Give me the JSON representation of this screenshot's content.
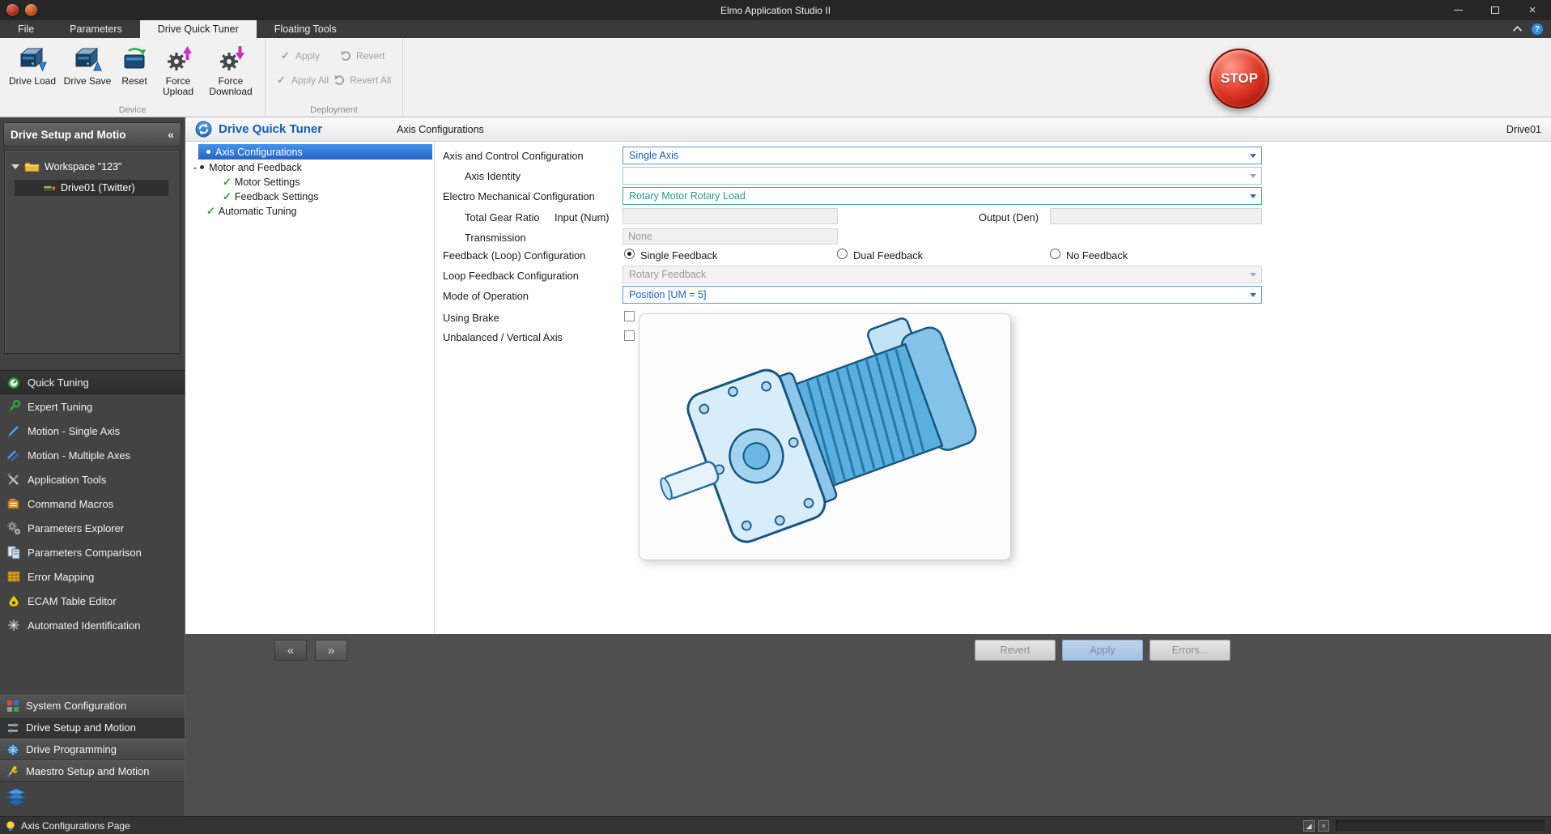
{
  "titlebar": {
    "title": "Elmo Application Studio II"
  },
  "menubar": {
    "tabs": [
      "File",
      "Parameters",
      "Drive Quick Tuner",
      "Floating Tools"
    ]
  },
  "ribbon": {
    "groups": {
      "device": {
        "label": "Device",
        "drive_load": "Drive Load",
        "drive_save": "Drive Save",
        "reset": "Reset",
        "force_upload": "Force Upload",
        "force_download": "Force Download"
      },
      "deployment": {
        "label": "Deployment",
        "apply": "Apply",
        "revert": "Revert",
        "apply_all": "Apply All",
        "revert_all": "Revert All"
      }
    },
    "stop": "STOP"
  },
  "sidebar": {
    "header": "Drive Setup and Motio",
    "workspace": "Workspace \"123\"",
    "drive": "Drive01 (Twitter)",
    "items": [
      {
        "label": "Quick Tuning"
      },
      {
        "label": "Expert Tuning"
      },
      {
        "label": "Motion - Single Axis"
      },
      {
        "label": "Motion - Multiple Axes"
      },
      {
        "label": "Application Tools"
      },
      {
        "label": "Command Macros"
      },
      {
        "label": "Parameters Explorer"
      },
      {
        "label": "Parameters Comparison"
      },
      {
        "label": "Error Mapping"
      },
      {
        "label": "ECAM Table Editor"
      },
      {
        "label": "Automated Identification"
      }
    ],
    "bottom_items": [
      {
        "label": "System Configuration"
      },
      {
        "label": "Drive Setup and Motion"
      },
      {
        "label": "Drive Programming"
      },
      {
        "label": "Maestro Setup and Motion"
      }
    ]
  },
  "content": {
    "header": {
      "title": "Drive Quick Tuner",
      "breadcrumb": "Axis Configurations",
      "drive_name": "Drive01"
    },
    "tree": {
      "axis_configurations": "Axis Configurations",
      "motor_and_feedback": "Motor and Feedback",
      "motor_settings": "Motor Settings",
      "feedback_settings": "Feedback Settings",
      "automatic_tuning": "Automatic Tuning"
    },
    "form": {
      "axis_control": {
        "label": "Axis and Control Configuration",
        "value": "Single Axis"
      },
      "axis_identity": {
        "label": "Axis Identity",
        "value": ""
      },
      "electro_mech": {
        "label": "Electro Mechanical Configuration",
        "value": "Rotary Motor Rotary Load"
      },
      "gear_ratio": {
        "label": "Total Gear Ratio",
        "input_label": "Input (Num)",
        "input_value": "",
        "output_label": "Output (Den)",
        "output_value": ""
      },
      "transmission": {
        "label": "Transmission",
        "value": "None"
      },
      "feedback_config": {
        "label": "Feedback (Loop) Configuration",
        "options": [
          "Single Feedback",
          "Dual Feedback",
          "No Feedback"
        ],
        "selected": "Single Feedback"
      },
      "loop_feedback": {
        "label": "Loop Feedback Configuration",
        "value": "Rotary Feedback"
      },
      "mode_of_operation": {
        "label": "Mode of Operation",
        "value": "Position [UM = 5]"
      },
      "using_brake": {
        "label": "Using Brake",
        "checked": false
      },
      "unbalanced": {
        "label": "Unbalanced / Vertical Axis",
        "checked": false
      }
    },
    "buttons": {
      "revert": "Revert",
      "apply": "Apply",
      "errors": "Errors..."
    }
  },
  "statusbar": {
    "text": "Axis Configurations Page"
  },
  "colors": {
    "accent_blue": "#1a62c8",
    "accent_teal": "#1f9e8e",
    "selection_blue": "#2f74d0",
    "stop_red": "#c41a0a",
    "check_green": "#2e9e3a"
  },
  "icons": {
    "collapse_double_left": "«",
    "nav_prev": "«",
    "nav_next": "»",
    "help": "?",
    "expander_collapse": "-",
    "check": "✓",
    "status_resize": "◢",
    "status_close": "×"
  }
}
